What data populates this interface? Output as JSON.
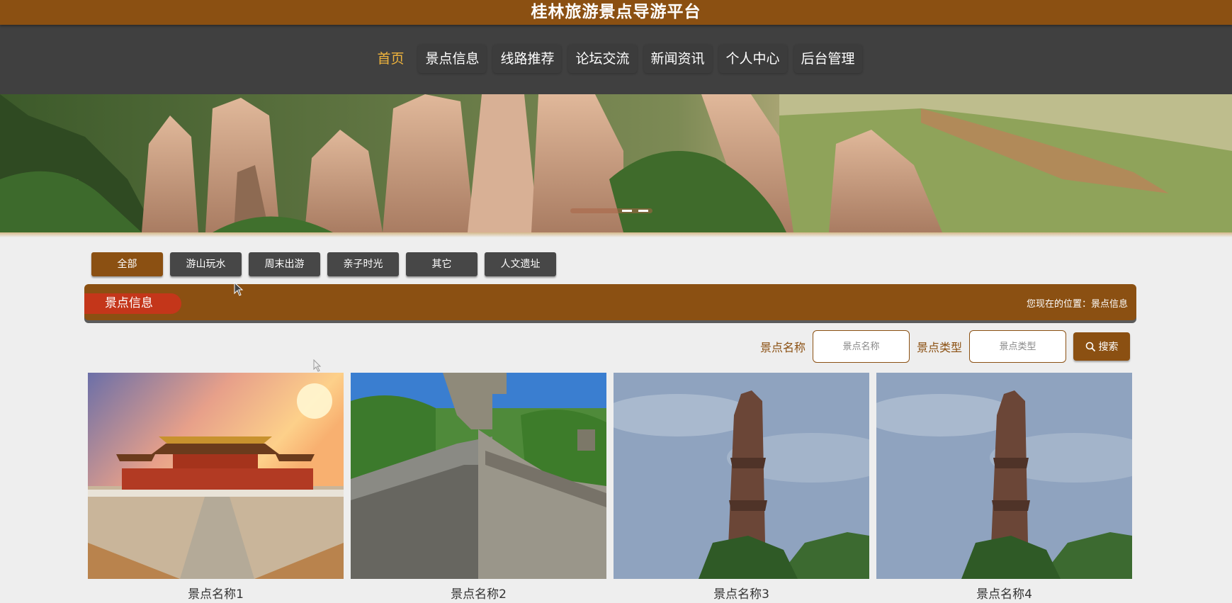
{
  "header": {
    "title": "桂林旅游景点导游平台"
  },
  "nav": {
    "items": [
      {
        "label": "首页",
        "active": true
      },
      {
        "label": "景点信息"
      },
      {
        "label": "线路推荐"
      },
      {
        "label": "论坛交流"
      },
      {
        "label": "新闻资讯"
      },
      {
        "label": "个人中心"
      },
      {
        "label": "后台管理"
      }
    ]
  },
  "filters": [
    {
      "label": "全部",
      "active": true
    },
    {
      "label": "游山玩水"
    },
    {
      "label": "周末出游"
    },
    {
      "label": "亲子时光"
    },
    {
      "label": "其它"
    },
    {
      "label": "人文遗址"
    }
  ],
  "section": {
    "title": "景点信息",
    "breadcrumb": "您现在的位置：景点信息"
  },
  "search": {
    "name_label": "景点名称",
    "name_placeholder": "景点名称",
    "type_label": "景点类型",
    "type_placeholder": "景点类型",
    "button_label": "搜索",
    "button_icon": "search-icon"
  },
  "cards": [
    {
      "name": "景点名称1",
      "image": "forbidden-city-photo"
    },
    {
      "name": "景点名称2",
      "image": "great-wall-photo"
    },
    {
      "name": "景点名称3",
      "image": "carved-stone-pillar-photo"
    },
    {
      "name": "景点名称4",
      "image": "carved-stone-pillar-photo"
    }
  ],
  "colors": {
    "brand": "#8b5012",
    "nav_bg": "#404040",
    "nav_active": "#f0b43c",
    "tag_red": "#c4361a",
    "page_bg": "#eeeeee"
  }
}
